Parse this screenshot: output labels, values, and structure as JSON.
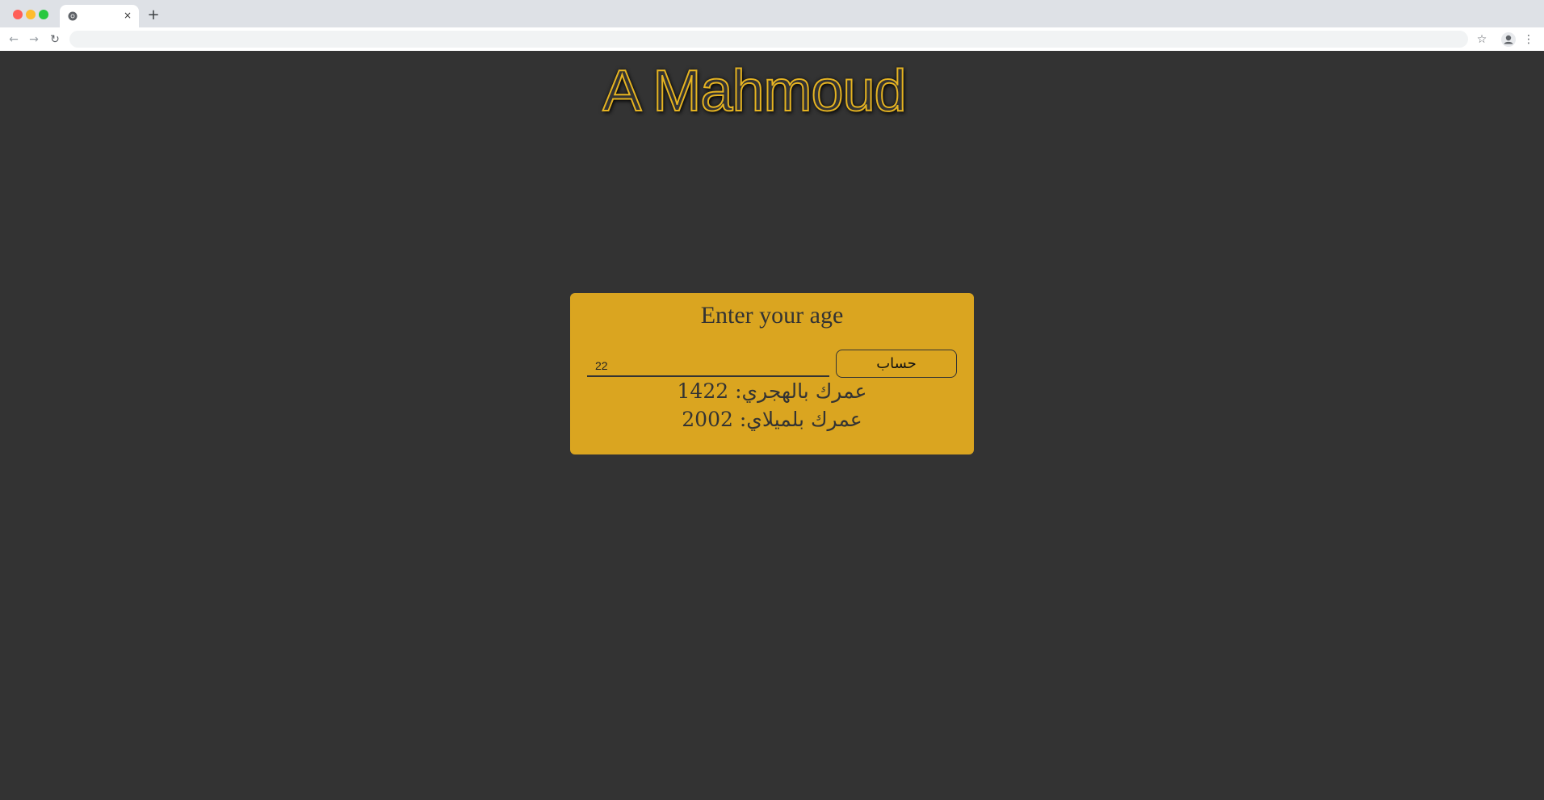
{
  "browser": {
    "tab": {
      "title": "",
      "close_glyph": "×",
      "favicon": "chrome-icon"
    },
    "new_tab_glyph": "+",
    "nav": {
      "back_glyph": "←",
      "forward_glyph": "→",
      "reload_glyph": "↻"
    },
    "address_bar": {
      "value": ""
    },
    "bookmark_glyph": "☆",
    "menu_glyph": "⋮"
  },
  "page": {
    "site_title": "A Mahmoud",
    "card": {
      "heading": "Enter your age",
      "age_input": {
        "value": "22",
        "placeholder": ""
      },
      "calculate_button_label": "حساب",
      "hijri_result": "عمرك بالهجري: 1422",
      "gregorian_result": "عمرك بلميلاي: 2002"
    }
  },
  "colors": {
    "background": "#333333",
    "card": "#daa520",
    "title_outline": "#e6b422",
    "text_dark": "#333333"
  }
}
